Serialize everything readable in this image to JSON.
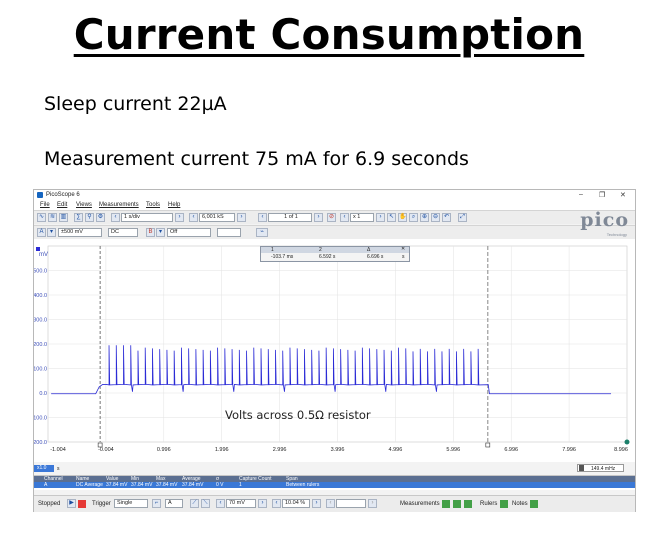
{
  "slide": {
    "title": "Current Consumption",
    "bullet1": "Sleep current 22µA",
    "bullet2": "Measurement current 75 mA for  6.9 seconds"
  },
  "window": {
    "title": "PicoScope 6",
    "controls": [
      "–",
      "❐",
      "✕"
    ],
    "menu": [
      "File",
      "Edit",
      "Views",
      "Measurements",
      "Tools",
      "Help"
    ]
  },
  "toolbar": {
    "timebase": "1 s/div",
    "samples": "6,001 kS",
    "buffer": "1 of 1",
    "zoom": "x 1",
    "channel_label": "A",
    "range": "±500 mV",
    "coupling": "DC",
    "ch_b_label": "B",
    "ch_b_state": "Off"
  },
  "logo": {
    "text": "pico",
    "sub": "Technology"
  },
  "plot": {
    "y_unit": "mV",
    "y_ticks": [
      "500.0",
      "400.0",
      "300.0",
      "200.0",
      "100.0",
      "0.0",
      "-100.0",
      "-200.0"
    ],
    "x_ticks": [
      "-1.004",
      "-0.004",
      "0.996",
      "1.996",
      "2.996",
      "3.996",
      "4.996",
      "5.996",
      "6.996",
      "7.996",
      "8.996"
    ],
    "annotation": "Volts across 0.5Ω resistor",
    "x_badge": "x1.0",
    "x_unit": "s",
    "freq_readout": "149.4 mHz",
    "trace_color": "#2b2bd6"
  },
  "rulers": {
    "col1": "1",
    "col2": "2",
    "col3": "Δ",
    "v1": "-103.7 ms",
    "v2": "6.592 s",
    "v3": "6.696 s",
    "unit": "s"
  },
  "channel_table": {
    "headers": [
      "Channel",
      "Name",
      "Value",
      "Min",
      "Max",
      "Average",
      "σ",
      "Capture Count",
      "Span"
    ],
    "row": [
      "A",
      "DC Average",
      "37.84 mV",
      "37.84 mV",
      "37.84 mV",
      "37.84 mV",
      "0 V",
      "1",
      "Between rulers"
    ]
  },
  "status": {
    "state": "Stopped",
    "trigger_label": "Trigger",
    "trigger_mode": "Single",
    "trigger_channel": "A",
    "trigger_level": "70 mV",
    "pretrigger": "10.04 %",
    "measurements_label": "Measurements",
    "rulers_label": "Rulers",
    "notes_label": "Notes"
  }
}
